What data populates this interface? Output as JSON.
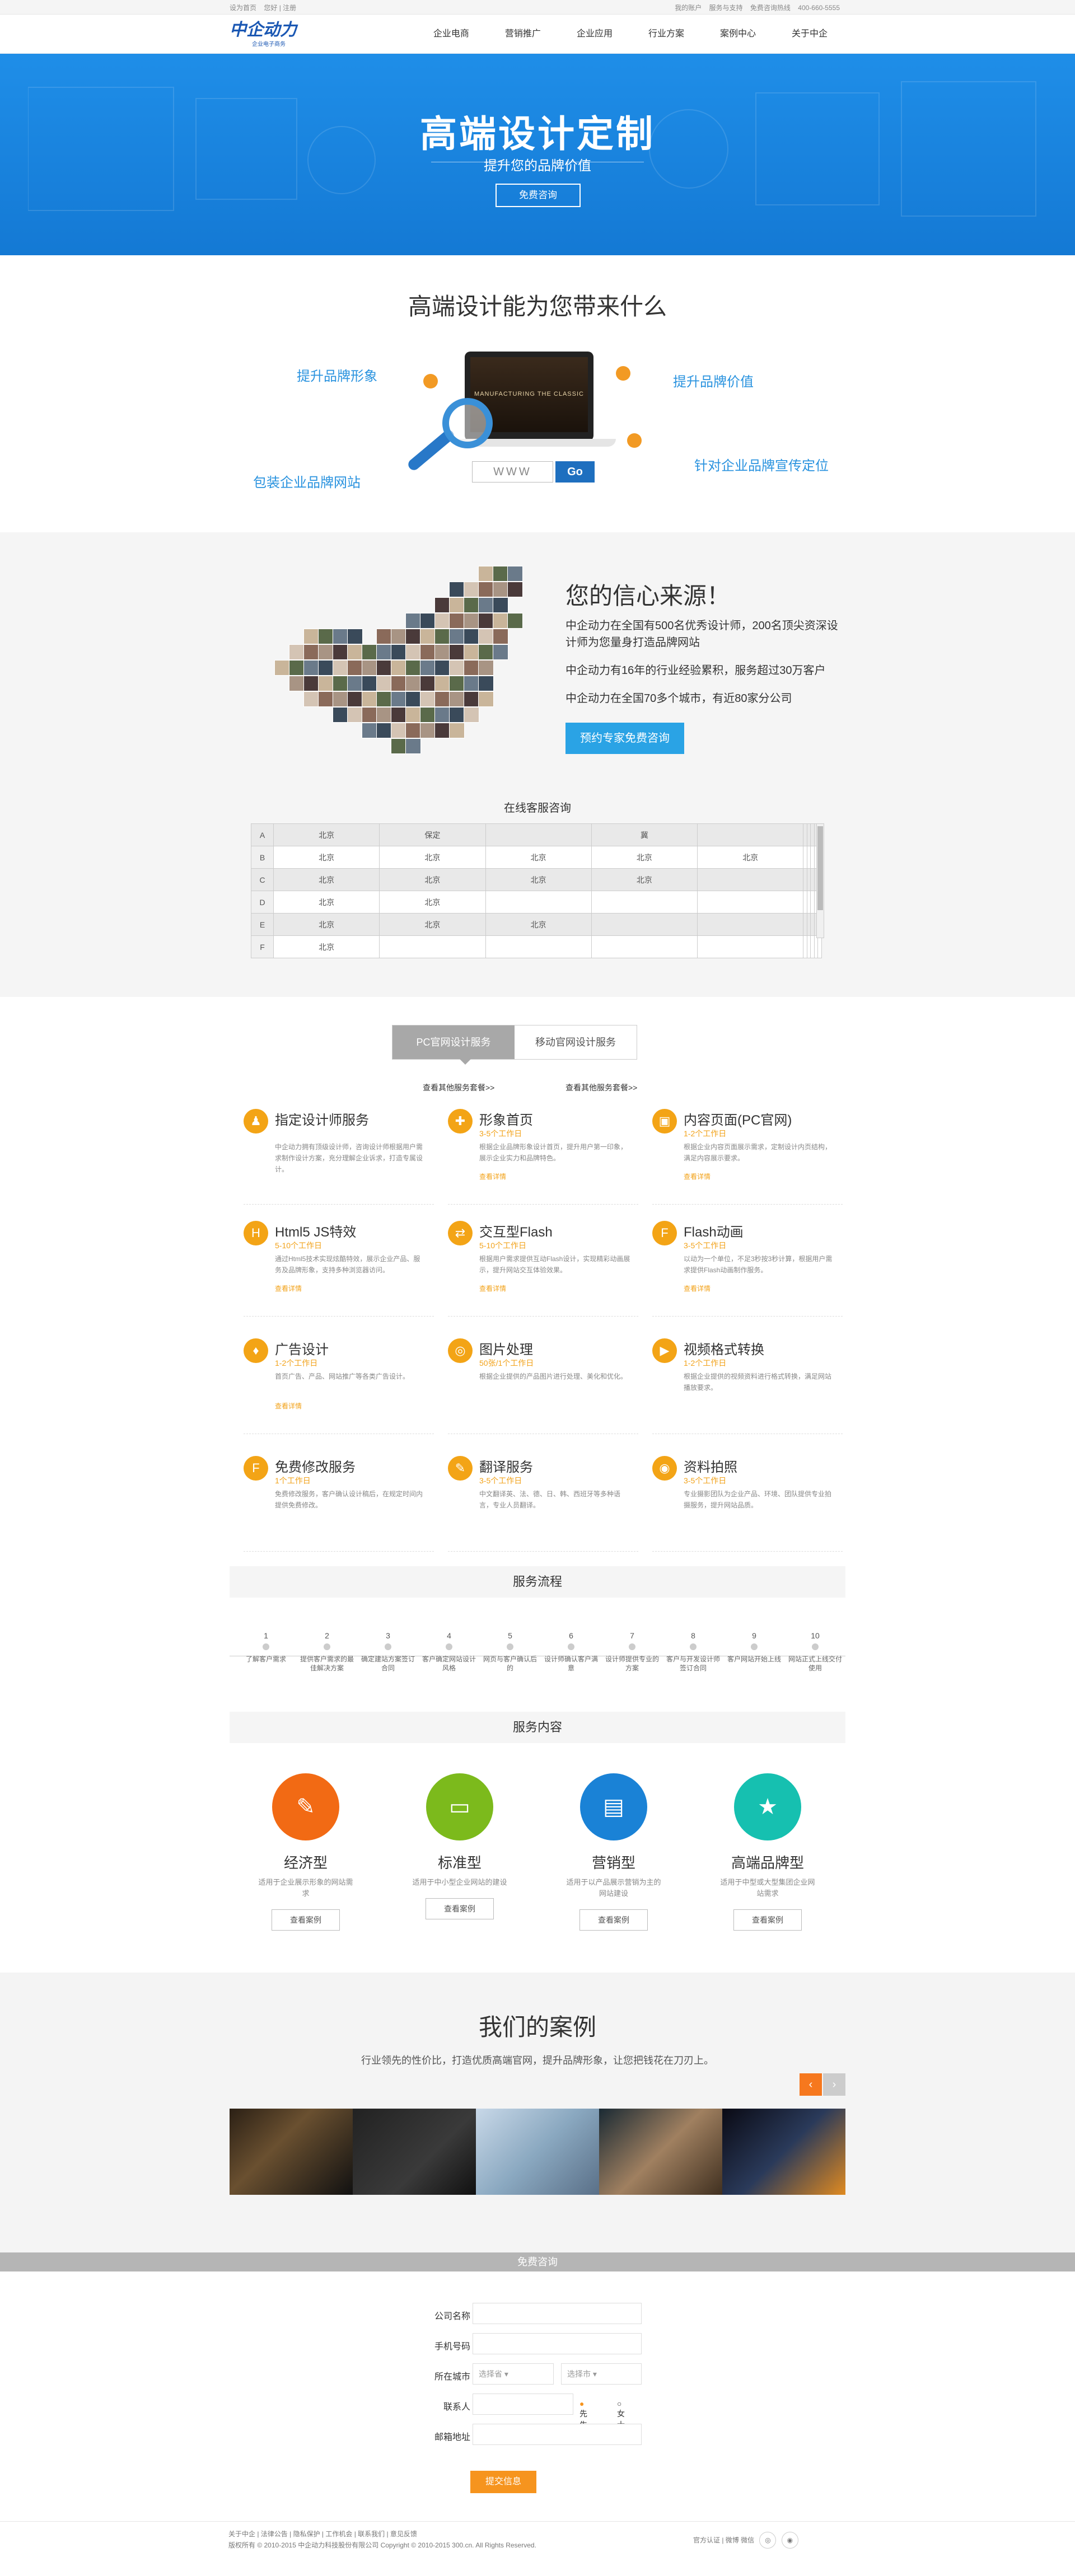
{
  "topbar": {
    "left": [
      "设为首页",
      "您好 | 注册"
    ],
    "right": [
      "我的账户",
      "服务与支持",
      "免费咨询热线",
      "400-660-5555"
    ]
  },
  "logo": {
    "main": "中企动力",
    "sub": "企业电子商务"
  },
  "nav": [
    "企业电商",
    "营销推广",
    "企业应用",
    "行业方案",
    "案例中心",
    "关于中企"
  ],
  "banner": {
    "title": "高端设计定制",
    "subtitle": "提升您的品牌价值",
    "button": "免费咨询"
  },
  "benefits": {
    "title": "高端设计能为您带来什么",
    "items": [
      "提升品牌形象",
      "提升品牌价值",
      "包装企业品牌网站",
      "针对企业品牌宣传定位"
    ],
    "url_placeholder": "WWW",
    "go": "Go",
    "screen_text": "MANUFACTURING THE CLASSIC"
  },
  "confidence": {
    "title": "您的信心来源！",
    "p1": "中企动力在全国有500名优秀设计师，200名顶尖资深设计师为您量身打造品牌网站",
    "p2": "中企动力有16年的行业经验累积，服务超过30万客户",
    "p3": "中企动力在全国70多个城市，有近80家分公司",
    "button": "预约专家免费咨询",
    "online_title": "在线客服咨询",
    "rows": [
      {
        "h": "A",
        "cells": [
          "北京",
          "保定",
          "",
          "冀",
          "",
          "",
          "",
          "",
          "",
          ""
        ]
      },
      {
        "h": "B",
        "cells": [
          "北京",
          "北京",
          "北京",
          "北京",
          "北京",
          "",
          "",
          "",
          "",
          ""
        ]
      },
      {
        "h": "C",
        "cells": [
          "北京",
          "北京",
          "北京",
          "北京",
          "",
          "",
          "",
          "",
          "",
          ""
        ]
      },
      {
        "h": "D",
        "cells": [
          "北京",
          "北京",
          "",
          "",
          "",
          "",
          "",
          "",
          "",
          ""
        ]
      },
      {
        "h": "E",
        "cells": [
          "北京",
          "北京",
          "北京",
          "",
          "",
          "",
          "",
          "",
          "",
          ""
        ]
      },
      {
        "h": "F",
        "cells": [
          "北京",
          "",
          "",
          "",
          "",
          "",
          "",
          "",
          "",
          ""
        ]
      }
    ]
  },
  "services": {
    "tabs": [
      "PC官网设计服务",
      "移动官网设计服务"
    ],
    "more_left": "查看其他服务套餐>>",
    "more_right": "查看其他服务套餐>>",
    "items": [
      {
        "icon": "♟",
        "title": "指定设计师服务",
        "time": "",
        "desc": "中企动力拥有顶级设计师，咨询设计师根据用户需求制作设计方案，充分理解企业诉求，打造专属设计。",
        "more": ""
      },
      {
        "icon": "✚",
        "title": "形象首页",
        "time": "3-5个工作日",
        "desc": "根据企业品牌形象设计首页，提升用户第一印象，展示企业实力和品牌特色。",
        "more": "查看详情"
      },
      {
        "icon": "▣",
        "title": "内容页面(PC官网)",
        "time": "1-2个工作日",
        "desc": "根据企业内容页面展示需求，定制设计内页结构，满足内容展示要求。",
        "more": "查看详情"
      },
      {
        "icon": "H",
        "title": "Html5 JS特效",
        "time": "5-10个工作日",
        "desc": "通过Html5技术实现炫酷特效，展示企业产品、服务及品牌形象，支持多种浏览器访问。",
        "more": "查看详情"
      },
      {
        "icon": "⇄",
        "title": "交互型Flash",
        "time": "5-10个工作日",
        "desc": "根据用户需求提供互动Flash设计，实现精彩动画展示，提升网站交互体验效果。",
        "more": "查看详情"
      },
      {
        "icon": "F",
        "title": "Flash动画",
        "time": "3-5个工作日",
        "desc": "以动为一个单位，不足3秒按3秒计算，根据用户需求提供Flash动画制作服务。",
        "more": "查看详情"
      },
      {
        "icon": "♦",
        "title": "广告设计",
        "time": "1-2个工作日",
        "desc": "首页广告、产品、网站推广等各类广告设计。",
        "more": "查看详情"
      },
      {
        "icon": "◎",
        "title": "图片处理",
        "time": "50张/1个工作日",
        "desc": "根据企业提供的产品图片进行处理、美化和优化。",
        "more": ""
      },
      {
        "icon": "▶",
        "title": "视频格式转换",
        "time": "1-2个工作日",
        "desc": "根据企业提供的视频资料进行格式转换，满足网站播放要求。",
        "more": ""
      },
      {
        "icon": "F",
        "title": "免费修改服务",
        "time": "1个工作日",
        "desc": "免费修改服务，客户确认设计稿后，在规定时间内提供免费修改。",
        "more": ""
      },
      {
        "icon": "✎",
        "title": "翻译服务",
        "time": "3-5个工作日",
        "desc": "中文翻译英、法、德、日、韩、西班牙等多种语言，专业人员翻译。",
        "more": ""
      },
      {
        "icon": "◉",
        "title": "资料拍照",
        "time": "3-5个工作日",
        "desc": "专业摄影团队为企业产品、环境、团队提供专业拍摄服务，提升网站品质。",
        "more": ""
      }
    ]
  },
  "process": {
    "title": "服务流程",
    "steps": [
      {
        "n": "1",
        "t": "了解客户需求"
      },
      {
        "n": "2",
        "t": "提供客户需求的最佳解决方案"
      },
      {
        "n": "3",
        "t": "确定建站方案签订合同"
      },
      {
        "n": "4",
        "t": "客户确定网站设计风格"
      },
      {
        "n": "5",
        "t": "网页与客户确认后的"
      },
      {
        "n": "6",
        "t": "设计师确认客户满意"
      },
      {
        "n": "7",
        "t": "设计师提供专业的方案"
      },
      {
        "n": "8",
        "t": "客户与开发设计师签订合同"
      },
      {
        "n": "9",
        "t": "客户网站开始上线"
      },
      {
        "n": "10",
        "t": "网站正式上线交付使用"
      }
    ]
  },
  "packages": {
    "title": "服务内容",
    "items": [
      {
        "name": "经济型",
        "desc": "适用于企业展示形象的网站需求",
        "btn": "查看案例",
        "color": "#f26a14",
        "icon": "✎"
      },
      {
        "name": "标准型",
        "desc": "适用于中小型企业网站的建设",
        "btn": "查看案例",
        "color": "#7cba1c",
        "icon": "▭"
      },
      {
        "name": "营销型",
        "desc": "适用于以产品展示营销为主的网站建设",
        "btn": "查看案例",
        "color": "#1a82d6",
        "icon": "▤"
      },
      {
        "name": "高端品牌型",
        "desc": "适用于中型或大型集团企业网站需求",
        "btn": "查看案例",
        "color": "#16c0b0",
        "icon": "★"
      }
    ]
  },
  "cases": {
    "title": "我们的案例",
    "subtitle": "行业领先的性价比，打造优质高端官网，提升品牌形象，让您把钱花在刀刃上。",
    "prev": "‹",
    "next": "›"
  },
  "form": {
    "bar": "免费咨询",
    "labels": [
      "公司名称",
      "手机号码",
      "所在城市",
      "联系人",
      "邮箱地址"
    ],
    "province": "选择省",
    "city": "选择市",
    "male": "先生",
    "female": "女士",
    "submit": "提交信息"
  },
  "footer": {
    "links": "关于中企 | 法律公告 | 隐私保护 | 工作机会 | 联系我们 | 意见反馈",
    "copy": "版权所有 © 2010-2015 中企动力科技股份有限公司   Copyright © 2010-2015 300.cn. All Rights Reserved.",
    "right": "官方认证 | 微博 微信"
  }
}
